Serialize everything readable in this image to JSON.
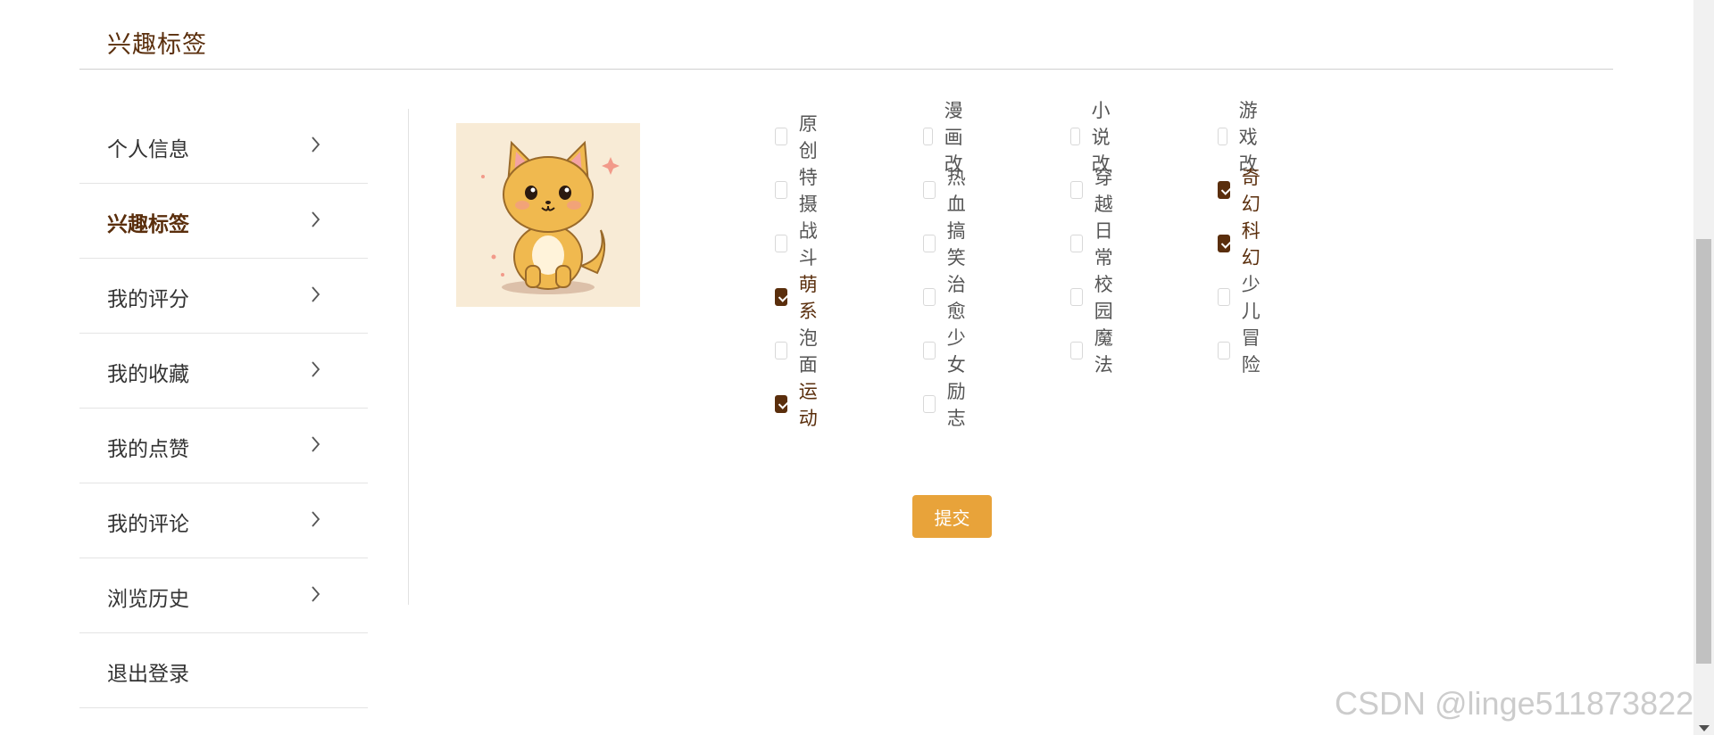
{
  "header": {
    "title": "兴趣标签"
  },
  "sidebar": {
    "items": [
      {
        "label": "个人信息",
        "active": false,
        "has_chevron": true
      },
      {
        "label": "兴趣标签",
        "active": true,
        "has_chevron": true
      },
      {
        "label": "我的评分",
        "active": false,
        "has_chevron": true
      },
      {
        "label": "我的收藏",
        "active": false,
        "has_chevron": true
      },
      {
        "label": "我的点赞",
        "active": false,
        "has_chevron": true
      },
      {
        "label": "我的评论",
        "active": false,
        "has_chevron": true
      },
      {
        "label": "浏览历史",
        "active": false,
        "has_chevron": true
      },
      {
        "label": "退出登录",
        "active": false,
        "has_chevron": false
      }
    ]
  },
  "avatar": {
    "icon": "cat-avatar-illustration"
  },
  "tags": {
    "rows": [
      [
        {
          "label": "原创",
          "checked": false
        },
        {
          "label": "漫画改",
          "checked": false
        },
        {
          "label": "小说改",
          "checked": false
        },
        {
          "label": "游戏改",
          "checked": false
        }
      ],
      [
        {
          "label": "特摄",
          "checked": false
        },
        {
          "label": "热血",
          "checked": false
        },
        {
          "label": "穿越",
          "checked": false
        },
        {
          "label": "奇幻",
          "checked": true
        }
      ],
      [
        {
          "label": "战斗",
          "checked": false
        },
        {
          "label": "搞笑",
          "checked": false
        },
        {
          "label": "日常",
          "checked": false
        },
        {
          "label": "科幻",
          "checked": true
        }
      ],
      [
        {
          "label": "萌系",
          "checked": true
        },
        {
          "label": "治愈",
          "checked": false
        },
        {
          "label": "校园",
          "checked": false
        },
        {
          "label": "少儿",
          "checked": false
        }
      ],
      [
        {
          "label": "泡面",
          "checked": false
        },
        {
          "label": "少女",
          "checked": false
        },
        {
          "label": "魔法",
          "checked": false
        },
        {
          "label": "冒险",
          "checked": false
        }
      ],
      [
        {
          "label": "运动",
          "checked": true
        },
        {
          "label": "励志",
          "checked": false
        }
      ]
    ]
  },
  "submit": {
    "label": "提交"
  },
  "watermark": {
    "text": "CSDN @linge511873822"
  },
  "colors": {
    "accent": "#5a2e0c",
    "button": "#e8a33a"
  }
}
